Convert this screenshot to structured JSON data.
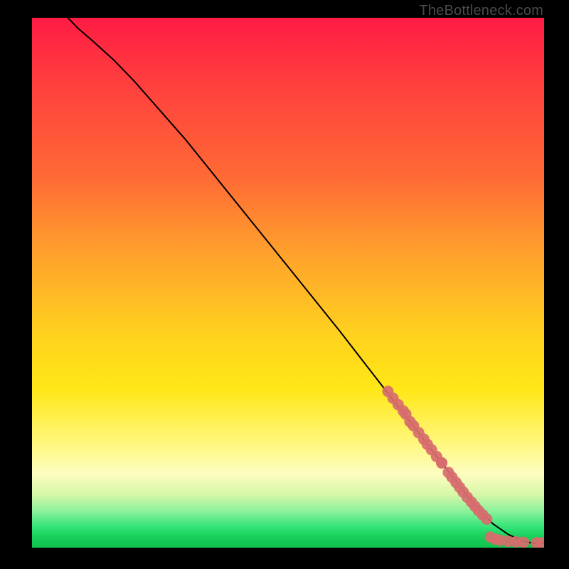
{
  "attribution": "TheBottleneck.com",
  "colors": {
    "dot": "#d76d6d",
    "curve": "#000000"
  },
  "chart_data": {
    "type": "line",
    "title": "",
    "xlabel": "",
    "ylabel": "",
    "xlim": [
      0,
      100
    ],
    "ylim": [
      0,
      100
    ],
    "grid": false,
    "legend": false,
    "series": [
      {
        "name": "curve",
        "kind": "line",
        "x": [
          7,
          9,
          12,
          16,
          20,
          30,
          40,
          50,
          60,
          68,
          72,
          76,
          80,
          84,
          87,
          90,
          93,
          96,
          98,
          100
        ],
        "y": [
          100,
          98,
          95.5,
          92,
          88,
          77,
          65,
          53,
          41,
          31,
          26,
          21,
          16,
          11,
          7.5,
          4.5,
          2.5,
          1.2,
          0.8,
          0.8
        ]
      },
      {
        "name": "cluster-upper",
        "kind": "scatter",
        "x": [
          69.5,
          70.5,
          71.5,
          72.5,
          73,
          73.8,
          74.5,
          75.5,
          76.5,
          77.2,
          78,
          79,
          80
        ],
        "y": [
          29.5,
          28.2,
          27,
          25.8,
          25.2,
          23.8,
          23,
          21.7,
          20.5,
          19.5,
          18.5,
          17.2,
          16
        ]
      },
      {
        "name": "cluster-mid",
        "kind": "scatter",
        "x": [
          80,
          81.3,
          82,
          82.8,
          83.5,
          84.2,
          85,
          85.8,
          86.5,
          87.2,
          88,
          88.8
        ],
        "y": [
          16,
          14.2,
          13.3,
          12.3,
          11.4,
          10.5,
          9.5,
          8.6,
          7.8,
          7,
          6.2,
          5.4
        ]
      },
      {
        "name": "cluster-bottom",
        "kind": "scatter",
        "x": [
          89.5,
          90.5,
          91.5,
          93,
          94.5,
          96,
          98.5,
          99.5
        ],
        "y": [
          2,
          1.6,
          1.4,
          1.2,
          1.1,
          1.0,
          0.9,
          0.9
        ]
      }
    ]
  }
}
